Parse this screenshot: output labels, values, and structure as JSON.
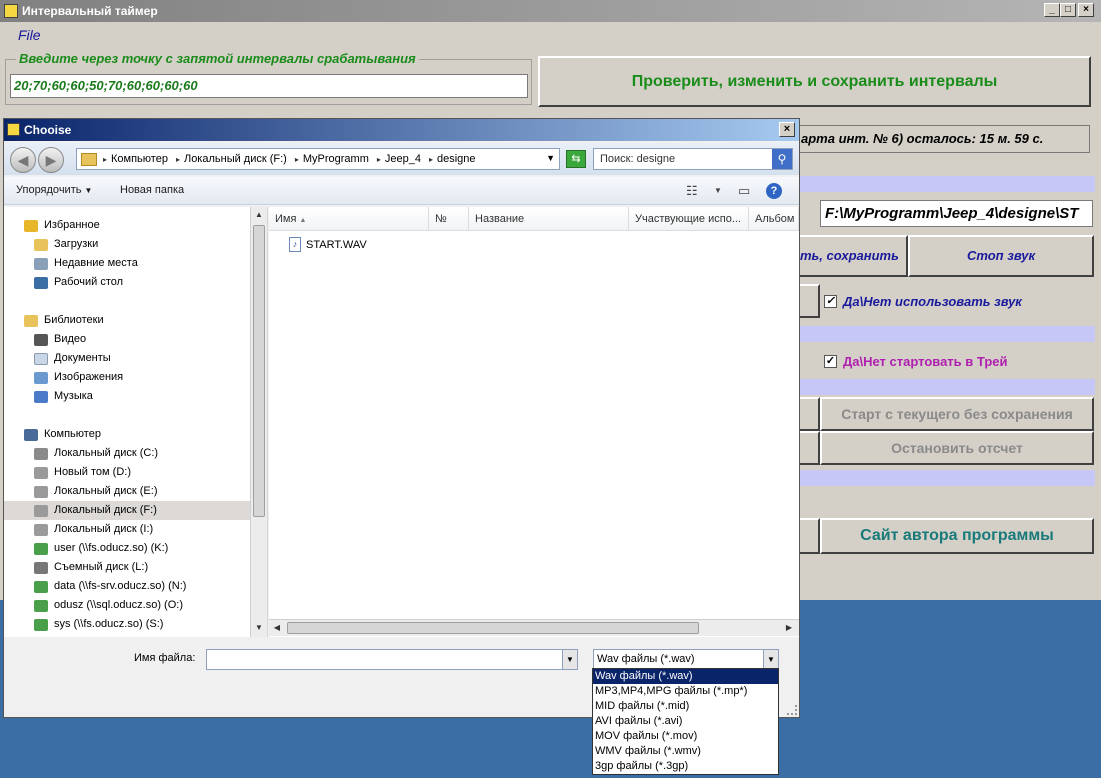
{
  "main": {
    "title": "Интервальный таймер",
    "menu_file": "File",
    "group_label": "Введите через точку с запятой интервалы срабатывания",
    "intervals_value": "20;70;60;60;50;70;60;60;60;60",
    "check_save_button": "Проверить, изменить и сохранить интервалы",
    "status_text": "арта инт. № 6) осталось: 15 м. 59 с.",
    "sound_path": "F:\\MyProgramm\\Jeep_4\\designe\\ST",
    "save_partial_button": "ть, сохранить",
    "stop_sound_button": "Стоп звук",
    "use_sound_label": "Да\\Нет использовать звук",
    "start_tray_label": "Да\\Нет стартовать в Трей",
    "start_current_button": "Старт с текущего без сохранения",
    "stop_count_button": "Остановить отсчет",
    "author_site_button": "Сайт автора программы",
    "minimize_glyph": "_",
    "maximize_glyph": "□",
    "close_glyph": "×",
    "check_mark": "✓"
  },
  "dialog": {
    "title": "Chooise",
    "close_glyph": "×",
    "back_glyph": "◀",
    "forward_glyph": "▶",
    "breadcrumbs": [
      "Компьютер",
      "Локальный диск (F:)",
      "MyProgramm",
      "Jeep_4",
      "designe"
    ],
    "crumb_arrow": "▸",
    "dropdown_glyph": "▼",
    "refresh_glyph": "⇆",
    "search_placeholder": "Поиск: designe",
    "search_glyph": "⚲",
    "organize": "Упорядочить",
    "new_folder": "Новая папка",
    "views_glyph": "☷",
    "preview_glyph": "▭",
    "help_glyph": "?",
    "nav": [
      {
        "label": "Избранное",
        "icon": "star-icon",
        "color": "#e8b62a"
      },
      {
        "label": "Загрузки",
        "icon": "downloads-icon",
        "color": "#e8c25a"
      },
      {
        "label": "Недавние места",
        "icon": "recent-places-icon",
        "color": "#8aa0b8"
      },
      {
        "label": "Рабочий стол",
        "icon": "desktop-icon",
        "color": "#3a6ea5"
      },
      {
        "label": "Библиотеки",
        "icon": "libraries-icon",
        "color": "#e8c25a"
      },
      {
        "label": "Видео",
        "icon": "video-icon",
        "color": "#555555"
      },
      {
        "label": "Документы",
        "icon": "documents-icon",
        "color": "#c9d6e6"
      },
      {
        "label": "Изображения",
        "icon": "images-icon",
        "color": "#6a9ad0"
      },
      {
        "label": "Музыка",
        "icon": "music-icon",
        "color": "#4a7ac8"
      },
      {
        "label": "Компьютер",
        "icon": "computer-icon",
        "color": "#4a6a9a"
      },
      {
        "label": "Локальный диск (C:)",
        "icon": "drive-c-icon",
        "color": "#8a8a8a"
      },
      {
        "label": "Новый том (D:)",
        "icon": "drive-icon",
        "color": "#9a9a9a"
      },
      {
        "label": "Локальный диск (E:)",
        "icon": "drive-icon",
        "color": "#9a9a9a"
      },
      {
        "label": "Локальный диск (F:)",
        "icon": "drive-icon",
        "color": "#9a9a9a"
      },
      {
        "label": "Локальный диск (I:)",
        "icon": "drive-icon",
        "color": "#9a9a9a"
      },
      {
        "label": "user (\\\\fs.oducz.so) (K:)",
        "icon": "network-drive-icon",
        "color": "#4aa04a"
      },
      {
        "label": "Съемный диск (L:)",
        "icon": "removable-drive-icon",
        "color": "#777777"
      },
      {
        "label": "data (\\\\fs-srv.oducz.so) (N:)",
        "icon": "network-drive-icon",
        "color": "#4aa04a"
      },
      {
        "label": "odusz (\\\\sql.oducz.so) (O:)",
        "icon": "network-drive-icon",
        "color": "#4aa04a"
      },
      {
        "label": "sys (\\\\fs.oducz.so) (S:)",
        "icon": "network-drive-icon",
        "color": "#4aa04a"
      }
    ],
    "columns": [
      "Имя",
      "№",
      "Название",
      "Участвующие испо...",
      "Альбом"
    ],
    "sort_glyph": "▲",
    "file_name": "START.WAV",
    "file_glyph": "♪",
    "scroll_up": "▲",
    "scroll_down": "▼",
    "scroll_left": "◀",
    "scroll_right": "▶",
    "filename_label": "Имя файла:",
    "filename_value": "",
    "filter_selected": "Wav файлы (*.wav)",
    "filter_options": [
      "Wav файлы (*.wav)",
      "MP3,MP4,MPG файлы (*.mp*)",
      "MID файлы (*.mid)",
      "AVI файлы (*.avi)",
      "MOV файлы (*.mov)",
      "WMV файлы (*.wmv)",
      "3gp файлы (*.3gp)"
    ]
  },
  "colors": {
    "accent_green": "#1a8c1a",
    "title_blue": "#0a246a",
    "teal_text": "#1a7a7a",
    "magenta_text": "#b020b0",
    "desktop": "#3a6ea5"
  }
}
